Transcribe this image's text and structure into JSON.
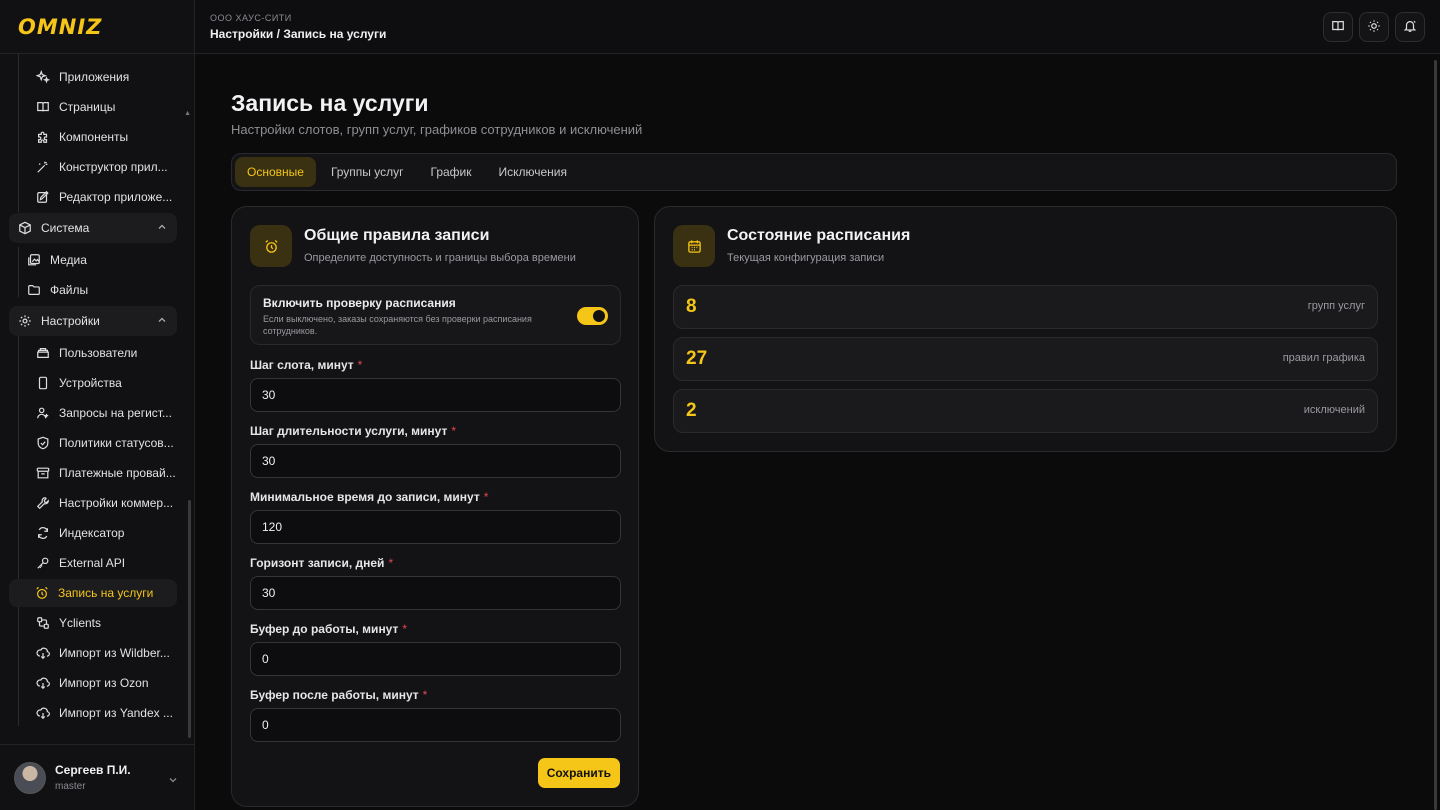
{
  "app": {
    "logo": "OMNIZ"
  },
  "header": {
    "org": "ООО ХАУС-СИТИ",
    "breadcrumb": "Настройки / Запись на услуги",
    "buttons": [
      "book-icon",
      "sun-icon",
      "bell-icon"
    ]
  },
  "sidebar": {
    "items": [
      {
        "label": "Приложения",
        "icon": "sparkles-icon"
      },
      {
        "label": "Страницы",
        "icon": "book-icon"
      },
      {
        "label": "Компоненты",
        "icon": "puzzle-icon"
      },
      {
        "label": "Конструктор прил...",
        "icon": "wand-icon"
      },
      {
        "label": "Редактор приложе...",
        "icon": "edit-icon"
      }
    ],
    "group_system": {
      "label": "Система",
      "icon": "box-icon"
    },
    "system_items": [
      {
        "label": "Медиа",
        "icon": "images-icon"
      },
      {
        "label": "Файлы",
        "icon": "folder-icon"
      }
    ],
    "group_settings": {
      "label": "Настройки",
      "icon": "gear-icon"
    },
    "settings_items": [
      {
        "label": "Пользователи",
        "icon": "users-icon"
      },
      {
        "label": "Устройства",
        "icon": "phone-icon"
      },
      {
        "label": "Запросы на регист...",
        "icon": "user-plus-icon"
      },
      {
        "label": "Политики статусов...",
        "icon": "shield-icon"
      },
      {
        "label": "Платежные провай...",
        "icon": "archive-icon"
      },
      {
        "label": "Настройки коммер...",
        "icon": "wrench-icon"
      },
      {
        "label": "Индексатор",
        "icon": "refresh-icon"
      },
      {
        "label": "External API",
        "icon": "key-icon"
      },
      {
        "label": "Запись на услуги",
        "icon": "alarm-icon"
      },
      {
        "label": "Yclients",
        "icon": "transfer-icon"
      },
      {
        "label": "Импорт из Wildber...",
        "icon": "cloud-download-icon"
      },
      {
        "label": "Импорт из Ozon",
        "icon": "cloud-download-icon"
      },
      {
        "label": "Импорт из Yandex ...",
        "icon": "cloud-download-icon"
      }
    ],
    "user": {
      "name": "Сергеев П.И.",
      "role": "master"
    }
  },
  "page": {
    "title": "Запись на услуги",
    "subtitle": "Настройки слотов, групп услуг, графиков сотрудников и исключений",
    "tabs": [
      "Основные",
      "Группы услуг",
      "График",
      "Исключения"
    ],
    "active_tab": "Основные"
  },
  "rules_card": {
    "title": "Общие правила записи",
    "description": "Определите доступность и границы выбора времени",
    "toggle": {
      "title": "Включить проверку расписания",
      "description": "Если выключено, заказы сохраняются без проверки расписания сотрудников.",
      "enabled": true
    },
    "fields": [
      {
        "label": "Шаг слота, минут",
        "value": "30"
      },
      {
        "label": "Шаг длительности услуги, минут",
        "value": "30"
      },
      {
        "label": "Минимальное время до записи, минут",
        "value": "120"
      },
      {
        "label": "Горизонт записи, дней",
        "value": "30"
      },
      {
        "label": "Буфер до работы, минут",
        "value": "0"
      },
      {
        "label": "Буфер после работы, минут",
        "value": "0"
      }
    ],
    "required_mark": "*",
    "save_label": "Сохранить"
  },
  "status_card": {
    "title": "Состояние расписания",
    "description": "Текущая конфигурация записи",
    "stats": [
      {
        "value": "8",
        "label": "групп услуг"
      },
      {
        "value": "27",
        "label": "правил графика"
      },
      {
        "value": "2",
        "label": "исключений"
      }
    ]
  },
  "colors": {
    "accent": "#f5c518",
    "background": "#0b0b0c",
    "required": "#e5484d"
  }
}
